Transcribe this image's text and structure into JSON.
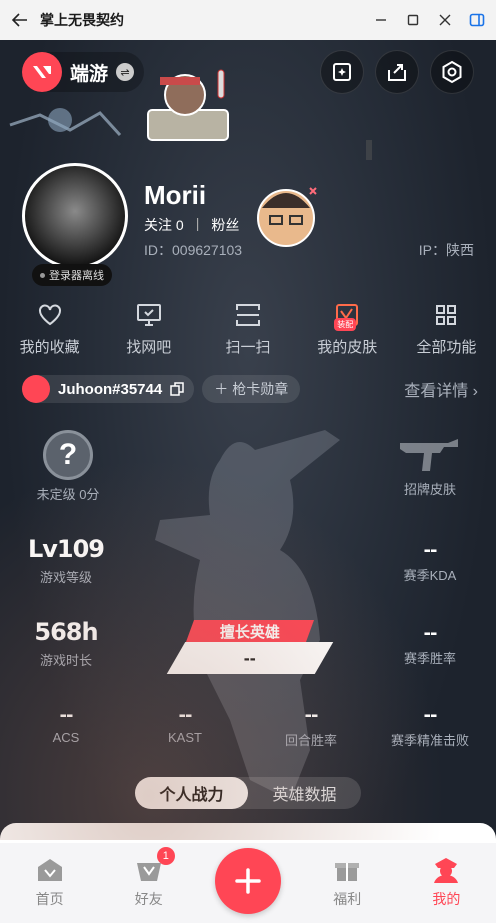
{
  "window": {
    "title": "掌上无畏契约"
  },
  "header": {
    "mode_label": "端游"
  },
  "profile": {
    "name": "Morii",
    "following_label": "关注",
    "following_count": "0",
    "followers_label": "粉丝",
    "id_label": "ID：009627103",
    "ip_label": "IP：陕西",
    "status": "登录器离线"
  },
  "menu": [
    {
      "label": "我的收藏",
      "icon": "heart-icon"
    },
    {
      "label": "找网吧",
      "icon": "monitor-icon"
    },
    {
      "label": "扫一扫",
      "icon": "scan-icon"
    },
    {
      "label": "我的皮肤",
      "icon": "skin-icon",
      "badge": "装配"
    },
    {
      "label": "全部功能",
      "icon": "grid-icon"
    }
  ],
  "riot": {
    "account": "Juhoon#35744",
    "medal_label": "枪卡勋章",
    "detail_label": "查看详情"
  },
  "stats": {
    "rank": {
      "value": "?",
      "label": "未定级 0分"
    },
    "signature_skin": {
      "label": "招牌皮肤"
    },
    "level": {
      "value": "Lv109",
      "label": "游戏等级"
    },
    "season_kda": {
      "value": "--",
      "label": "赛季KDA"
    },
    "play_time": {
      "value": "568h",
      "label": "游戏时长"
    },
    "season_winrate": {
      "value": "--",
      "label": "赛季胜率"
    },
    "favorite_agent": {
      "tag": "擅长英雄",
      "value": "--"
    },
    "acs": {
      "value": "--",
      "label": "ACS"
    },
    "kast": {
      "value": "--",
      "label": "KAST"
    },
    "round_winrate": {
      "value": "--",
      "label": "回合胜率"
    },
    "headshot": {
      "value": "--",
      "label": "赛季精准击败"
    }
  },
  "toggle": {
    "options": [
      "个人战力",
      "英雄数据"
    ],
    "active": 0
  },
  "tabbar": {
    "tabs": [
      {
        "label": "首页",
        "icon": "home-icon"
      },
      {
        "label": "好友",
        "icon": "friends-icon",
        "count": "1"
      },
      {
        "label": "",
        "icon": "plus-icon"
      },
      {
        "label": "福利",
        "icon": "gift-icon"
      },
      {
        "label": "我的",
        "icon": "profile-icon"
      }
    ],
    "active": 4
  },
  "colors": {
    "accent": "#ff4655",
    "background": "#1f2733",
    "muted_text": "#a9b0bb"
  }
}
